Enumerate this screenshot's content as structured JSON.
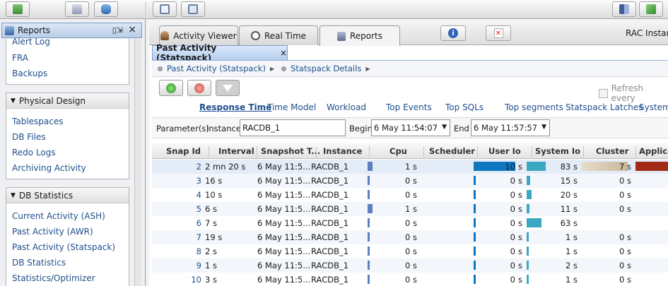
{
  "left_panel": {
    "title": "Reports",
    "partial_item": "Alert Log",
    "top_items": [
      "FRA",
      "Backups"
    ],
    "physical_design": {
      "title": "Physical Design",
      "items": [
        "Tablespaces",
        "DB Files",
        "Redo Logs",
        "Archiving Activity"
      ]
    },
    "db_statistics": {
      "title": "DB Statistics",
      "items": [
        "Current Activity (ASH)",
        "Past Activity (AWR)",
        "Past Activity (Statspack)",
        "DB Statistics",
        "Statistics/Optimizer"
      ]
    }
  },
  "tabs": {
    "activity_viewer": "Activity Viewer",
    "real_time": "Real Time",
    "reports": "Reports",
    "rac_instance": "RAC Instanc"
  },
  "subtab": {
    "title": "Past Activity (Statspack)",
    "close": "×"
  },
  "breadcrumb": [
    "Past Activity (Statspack)",
    "Statspack Details"
  ],
  "refresh_label": "Refresh every",
  "sections": [
    "Response Time",
    "Time Model",
    "Workload",
    "Top Events",
    "Top SQLs",
    "Top segments",
    "Statspack Latches",
    "System"
  ],
  "params": {
    "label": "Parameter(s)",
    "instance_label": "Instance",
    "instance_value": "RACDB_1",
    "begin_label": "Begin",
    "begin_value": "6 May  11:54:07",
    "end_label": "End",
    "end_value": "6 May  11:57:57"
  },
  "columns": [
    "Snap Id",
    "Interval",
    "Snapshot T...",
    "Instance",
    "Cpu",
    "Scheduler",
    "User Io",
    "System Io",
    "Cluster",
    "Applica"
  ],
  "rows": [
    {
      "snap": "2",
      "interval": "2 mn 20 s",
      "snapshot": "6 May  11:5...",
      "instance": "RACDB_1",
      "cpu": "1 s",
      "user_io": "10",
      "user_io_unit": "s",
      "sys_io": "83 s",
      "cluster": "7 s",
      "cpu_frac": 0.12,
      "uio_frac": 1.0,
      "sio_frac": 0.95,
      "cl_frac": 1.0,
      "app_frac": 1.0
    },
    {
      "snap": "3",
      "interval": "16 s",
      "snapshot": "6 May  11:5...",
      "instance": "RACDB_1",
      "cpu": "0 s",
      "user_io": "0",
      "user_io_unit": "s",
      "sys_io": "15 s",
      "cluster": "0 s",
      "cpu_frac": 0.02,
      "uio_frac": 0.03,
      "sio_frac": 0.18,
      "cl_frac": 0,
      "app_frac": 0
    },
    {
      "snap": "4",
      "interval": "10 s",
      "snapshot": "6 May  11:5...",
      "instance": "RACDB_1",
      "cpu": "0 s",
      "user_io": "0",
      "user_io_unit": "s",
      "sys_io": "20 s",
      "cluster": "0 s",
      "cpu_frac": 0.02,
      "uio_frac": 0.03,
      "sio_frac": 0.24,
      "cl_frac": 0,
      "app_frac": 0
    },
    {
      "snap": "5",
      "interval": "6 s",
      "snapshot": "6 May  11:5...",
      "instance": "RACDB_1",
      "cpu": "1 s",
      "user_io": "0",
      "user_io_unit": "s",
      "sys_io": "11 s",
      "cluster": "0 s",
      "cpu_frac": 0.12,
      "uio_frac": 0.03,
      "sio_frac": 0.13,
      "cl_frac": 0,
      "app_frac": 0
    },
    {
      "snap": "6",
      "interval": "7 s",
      "snapshot": "6 May  11:5...",
      "instance": "RACDB_1",
      "cpu": "0 s",
      "user_io": "0",
      "user_io_unit": "s",
      "sys_io": "63 s",
      "cluster": "",
      "cpu_frac": 0.02,
      "uio_frac": 0.03,
      "sio_frac": 0.76,
      "cl_frac": 0,
      "app_frac": 0
    },
    {
      "snap": "7",
      "interval": "19 s",
      "snapshot": "6 May  11:5...",
      "instance": "RACDB_1",
      "cpu": "0 s",
      "user_io": "0",
      "user_io_unit": "s",
      "sys_io": "1 s",
      "cluster": "0 s",
      "cpu_frac": 0.02,
      "uio_frac": 0.03,
      "sio_frac": 0.02,
      "cl_frac": 0,
      "app_frac": 0
    },
    {
      "snap": "8",
      "interval": "2 s",
      "snapshot": "6 May  11:5...",
      "instance": "RACDB_1",
      "cpu": "0 s",
      "user_io": "0",
      "user_io_unit": "s",
      "sys_io": "1 s",
      "cluster": "0 s",
      "cpu_frac": 0.02,
      "uio_frac": 0.03,
      "sio_frac": 0.02,
      "cl_frac": 0,
      "app_frac": 0
    },
    {
      "snap": "9",
      "interval": "1 s",
      "snapshot": "6 May  11:5...",
      "instance": "RACDB_1",
      "cpu": "0 s",
      "user_io": "0",
      "user_io_unit": "s",
      "sys_io": "2 s",
      "cluster": "0 s",
      "cpu_frac": 0.02,
      "uio_frac": 0.03,
      "sio_frac": 0.03,
      "cl_frac": 0,
      "app_frac": 0
    },
    {
      "snap": "10",
      "interval": "3 s",
      "snapshot": "6 May  11:5...",
      "instance": "RACDB_1",
      "cpu": "0 s",
      "user_io": "0",
      "user_io_unit": "s",
      "sys_io": "1 s",
      "cluster": "0 s",
      "cpu_frac": 0.02,
      "uio_frac": 0.03,
      "sio_frac": 0.02,
      "cl_frac": 0,
      "app_frac": 0
    }
  ],
  "colors": {
    "cpu_bar": "#5b7fc0",
    "user_io_bar": "#0e77bf",
    "system_io_bar": "#3aa7c3",
    "cluster_bar": "#c9b79a",
    "application_bar": "#a12b18",
    "link": "#1f4f8c"
  }
}
